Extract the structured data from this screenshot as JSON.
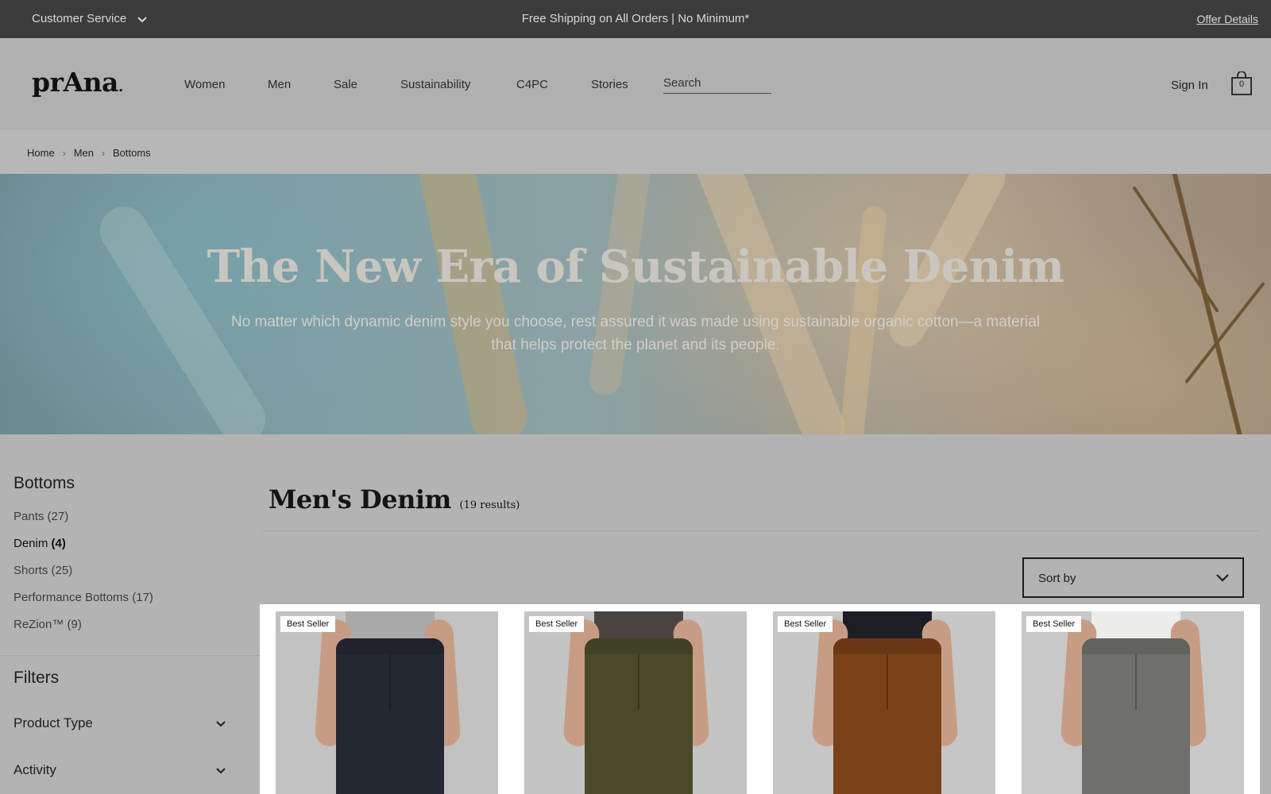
{
  "topbar": {
    "customer_service": "Customer Service",
    "promo": "Free Shipping on All Orders | No Minimum*",
    "offer_details": "Offer Details"
  },
  "header": {
    "logo": "prAna",
    "nav": [
      "Women",
      "Men",
      "Sale",
      "Sustainability",
      "C4PC",
      "Stories"
    ],
    "search_placeholder": "Search",
    "sign_in": "Sign In",
    "cart_count": "0"
  },
  "breadcrumb": [
    "Home",
    "Men",
    "Bottoms"
  ],
  "hero": {
    "title": "The New Era of Sustainable Denim",
    "subtitle": "No matter which dynamic denim style you choose, rest assured it was made using sustainable organic cotton—a material that helps protect the planet and its people."
  },
  "sidebar": {
    "title": "Bottoms",
    "categories": [
      {
        "name": "Pants",
        "count": "(27)"
      },
      {
        "name": "Denim",
        "count": "(4)"
      },
      {
        "name": "Shorts",
        "count": "(25)"
      },
      {
        "name": "Performance Bottoms",
        "count": "(17)"
      },
      {
        "name": "ReZion™",
        "count": "(9)"
      }
    ],
    "filters_title": "Filters",
    "filters": [
      "Product Type",
      "Activity"
    ]
  },
  "main": {
    "title": "Men's Denim",
    "count": "(19 results)",
    "sort_label": "Sort by"
  },
  "products": [
    {
      "badge": "Best Seller",
      "shirt_color": "#a9a9a9",
      "pants_color": "#242832",
      "bg": "#c2c2c2"
    },
    {
      "badge": "Best Seller",
      "shirt_color": "#4a4440",
      "pants_color": "#4a4a2a",
      "bg": "#c4c4c4"
    },
    {
      "badge": "Best Seller",
      "shirt_color": "#1c1e26",
      "pants_color": "#7a4018",
      "bg": "#c6c6c6"
    },
    {
      "badge": "Best Seller",
      "shirt_color": "#ececea",
      "pants_color": "#6f6f6c",
      "bg": "#c8c8c8"
    }
  ]
}
